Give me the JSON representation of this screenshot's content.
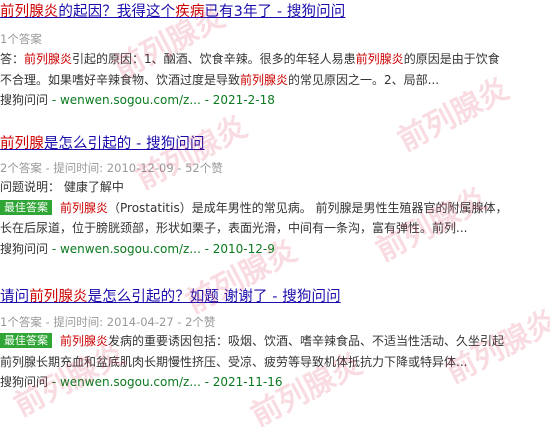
{
  "results": [
    {
      "title_parts": [
        {
          "text": "前列腺炎",
          "hl": true
        },
        {
          "text": "的起因？我得这个",
          "hl": false
        },
        {
          "text": "疾病",
          "hl": true
        },
        {
          "text": "已有3年了 - 搜狗问问",
          "hl": false
        }
      ],
      "meta": "1个答案",
      "answer_label": "答：",
      "answer_parts": [
        {
          "text": "前列腺炎",
          "hl": true
        },
        {
          "text": "引起的原因：1、酗酒、饮食辛辣。很多的年轻人易患",
          "hl": false
        },
        {
          "text": "前列腺炎",
          "hl": true
        },
        {
          "text": "的原因是由于饮食",
          "hl": false
        }
      ],
      "answer_line2_parts": [
        {
          "text": "不合理。如果嗜好辛辣食物、饮酒过度是导致",
          "hl": false
        },
        {
          "text": "前列腺炎",
          "hl": true
        },
        {
          "text": "的常见原因之一。2、局部...",
          "hl": false
        }
      ],
      "source": {
        "name": "搜狗问问",
        "domain": "wenwen.sogou.com/z...",
        "date": "2021-2-18"
      }
    },
    {
      "title_parts": [
        {
          "text": "前列腺",
          "hl": true
        },
        {
          "text": "是怎么引起的 - 搜狗问问",
          "hl": false
        }
      ],
      "meta": "2个答案 - 提问时间: 2010-12-09 - 52个赞",
      "question_label": "问题说明：",
      "question_text": "健康了解中",
      "badge": "最佳答案",
      "best_parts": [
        {
          "text": "前列腺炎",
          "hl": true
        },
        {
          "text": "（Prostatitis）是成年男性的常见病。 前列腺是男性生殖器官的附属腺体，",
          "hl": false
        }
      ],
      "best_line2": "长在后尿道，位于膀胱颈部，形状如栗子，表面光滑，中间有一条沟，富有弹性。前列...",
      "source": {
        "name": "搜狗问问",
        "domain": "wenwen.sogou.com/z...",
        "date": "2010-12-9"
      }
    },
    {
      "title_parts": [
        {
          "text": "请问",
          "hl": false
        },
        {
          "text": "前列腺炎",
          "hl": true
        },
        {
          "text": "是怎么引起的？如题 谢谢了 - 搜狗问问",
          "hl": false
        }
      ],
      "meta": "1个答案 - 提问时间: 2014-04-27 - 2个赞",
      "badge": "最佳答案",
      "best_parts": [
        {
          "text": "前列腺炎",
          "hl": true
        },
        {
          "text": "发病的重要诱因包括：吸烟、饮酒、嗜辛辣食品、不适当性活动、久坐引起",
          "hl": false
        }
      ],
      "best_line2": "前列腺长期充血和盆底肌肉长期慢性挤压、受凉、疲劳等导致机体抵抗力下降或特异体...",
      "source": {
        "name": "搜狗问问",
        "domain": "wenwen.sogou.com/z...",
        "date": "2021-11-16"
      }
    }
  ],
  "watermark": "前列腺炎"
}
